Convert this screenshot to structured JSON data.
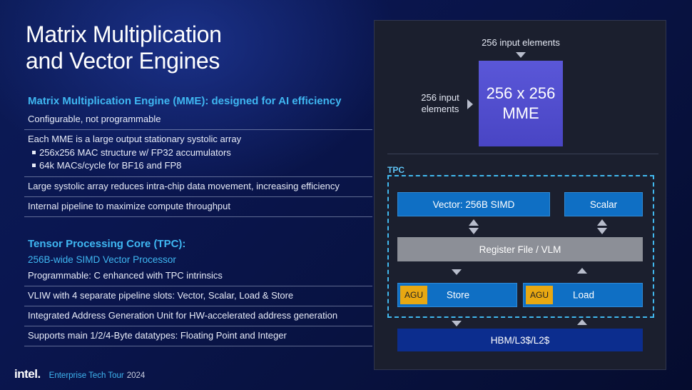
{
  "title_line1": "Matrix Multiplication",
  "title_line2": "and Vector Engines",
  "mme_section": {
    "heading": "Matrix Multiplication Engine (MME): designed for AI efficiency",
    "rows": [
      {
        "text": "Configurable, not programmable"
      },
      {
        "text": "Each MME is a large output stationary systolic array",
        "bullets": [
          "256x256 MAC structure w/ FP32 accumulators",
          "64k MACs/cycle for BF16 and FP8"
        ]
      },
      {
        "text": "Large systolic array reduces intra-chip data movement, increasing efficiency"
      },
      {
        "text": "Internal pipeline to maximize compute throughput"
      }
    ]
  },
  "tpc_section": {
    "heading": "Tensor Processing Core (TPC):",
    "subheading": "256B-wide SIMD Vector Processor",
    "rows": [
      {
        "text": "Programmable: C enhanced with TPC intrinsics"
      },
      {
        "text": "VLIW with 4 separate pipeline slots: Vector, Scalar, Load & Store"
      },
      {
        "text": "Integrated Address Generation Unit for HW-accelerated address generation"
      },
      {
        "text": "Supports main 1/2/4-Byte datatypes: Floating Point and Integer"
      }
    ]
  },
  "diagram": {
    "top_input": "256 input elements",
    "side_input_line1": "256 input",
    "side_input_line2": "elements",
    "mme_line1": "256 x 256",
    "mme_line2": "MME",
    "tpc_label": "TPC",
    "vector": "Vector: 256B SIMD",
    "scalar": "Scalar",
    "register_file": "Register File / VLM",
    "agu": "AGU",
    "store": "Store",
    "load": "Load",
    "memory": "HBM/L3$/L2$"
  },
  "footer": {
    "logo": "intel.",
    "event": "Enterprise Tech Tour",
    "year": "2024"
  },
  "colors": {
    "accent": "#3fb7f2",
    "mme": "#5a57d8",
    "unit_blue": "#0f6fc4",
    "agu": "#e8a812",
    "register_gray": "#8c8f97",
    "memory_navy": "#0c2d8e"
  }
}
